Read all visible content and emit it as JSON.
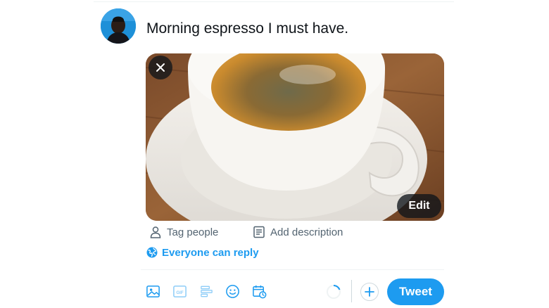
{
  "composer": {
    "text": "Morning espresso I must have.",
    "media": {
      "description": "espresso-cup-photo",
      "edit_label": "Edit",
      "remove_icon": "close-icon"
    },
    "tag_people_label": "Tag people",
    "add_description_label": "Add description",
    "reply_setting_label": "Everyone can reply"
  },
  "toolbar": {
    "icons": [
      "media-icon",
      "gif-icon",
      "poll-icon",
      "emoji-icon",
      "schedule-icon"
    ],
    "gif_text": "GIF",
    "tweet_label": "Tweet"
  },
  "colors": {
    "accent": "#1d9bf0",
    "text": "#0f1419",
    "muted": "#536471",
    "divider": "#eff3f4"
  }
}
